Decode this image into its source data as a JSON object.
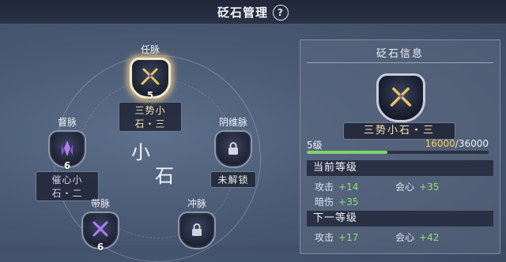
{
  "header": {
    "title": "砭石管理",
    "help_icon": "question-icon",
    "help_label": "?"
  },
  "wheel": {
    "center_top": "小",
    "center_bottom": "石"
  },
  "nodes": [
    {
      "name": "任脉",
      "level": "5",
      "tag": "三势小石・三",
      "icon": "crossed-swords-icon",
      "state": "selected"
    },
    {
      "name": "督脉",
      "level": "6",
      "tag": "催心小石・二",
      "icon": "purple-crystal-icon",
      "state": "equipped"
    },
    {
      "name": "阴维脉",
      "tag": "未解锁",
      "icon": "lock-icon",
      "state": "locked"
    },
    {
      "name": "带脉",
      "level": "6",
      "icon": "crossed-swords-purple-icon",
      "state": "equipped"
    },
    {
      "name": "冲脉",
      "icon": "lock-icon",
      "state": "locked"
    }
  ],
  "panel": {
    "title": "砭石信息",
    "item_name": "三势小石・三",
    "level": "5级",
    "exp_current": "16000",
    "exp_total": "/36000",
    "exp_progress": 0.444,
    "current": {
      "heading": "当前等级",
      "stats": [
        {
          "label": "攻击",
          "value": "+14"
        },
        {
          "label": "会心",
          "value": "+35"
        },
        {
          "label": "暗伤",
          "value": "+35"
        }
      ]
    },
    "next": {
      "heading": "下一等级",
      "stats": [
        {
          "label": "攻击",
          "value": "+17"
        },
        {
          "label": "会心",
          "value": "+42"
        }
      ]
    }
  },
  "colors": {
    "gold_text": "#f5e6b8",
    "exp_value": "#f3cf5a",
    "stat_green": "#8ee07a",
    "exp_bar": "#7fd46a"
  }
}
